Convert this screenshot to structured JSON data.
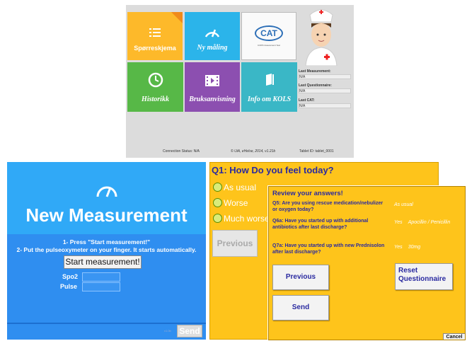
{
  "home": {
    "tiles": {
      "questionnaire": "Spørreskjema",
      "new_measurement": "Ny måling",
      "cat_logo": "CAT",
      "cat_sub": "COPD Assessment Test",
      "history": "Historikk",
      "manual": "Bruksanvisning",
      "info": "Info om KOLS"
    },
    "last_measurement_label": "Last Measurement:",
    "last_measurement_value": "N/A",
    "last_questionnaire_label": "Last Questionnaire:",
    "last_questionnaire_value": "N/A",
    "last_cat_label": "Last CAT:",
    "last_cat_value": "N/A",
    "connection_status": "Connection Status: N/A",
    "copyright": "© UiA, eHelse, 2014, v1.21b",
    "tablet_id": "Tablet ID: tablet_0001",
    "colors": {
      "questionnaire": "#fdb92a",
      "measurement": "#2bb4ea",
      "history": "#57b847",
      "manual": "#8c4fb0",
      "info": "#3ab7c6"
    }
  },
  "measurement": {
    "title": "New Measurement",
    "instruction_1": "1- Press \"Start measurement!\"",
    "instruction_2": "2- Put the pulseoxymeter on your finger. It starts automatically.",
    "start_button": "Start measurement!",
    "spo2_label": "Spo2",
    "pulse_label": "Pulse",
    "version": "v1.0b",
    "send_button": "Send"
  },
  "q1": {
    "question": "Q1: How Do you feel today?",
    "options": [
      "As usual",
      "Worse",
      "Much worse"
    ],
    "previous_button": "Previous"
  },
  "review": {
    "title": "Review your answers!",
    "items": [
      {
        "question": "Q5: Are you using rescue medication/nebulizer or oxygen today?",
        "answer": "As usual",
        "detail": ""
      },
      {
        "question": "Q6a: Have you started up with additional antibiotics after last discharge?",
        "answer": "Yes",
        "detail": "Apocillin / Penicillin"
      },
      {
        "question": "Q7a: Have you started up with new Prednisolon after last discharge?",
        "answer": "Yes",
        "detail": "30mg"
      }
    ],
    "previous_button": "Previous",
    "reset_button": "Reset Questionnaire",
    "send_button": "Send",
    "cancel_button": "Cancel"
  }
}
